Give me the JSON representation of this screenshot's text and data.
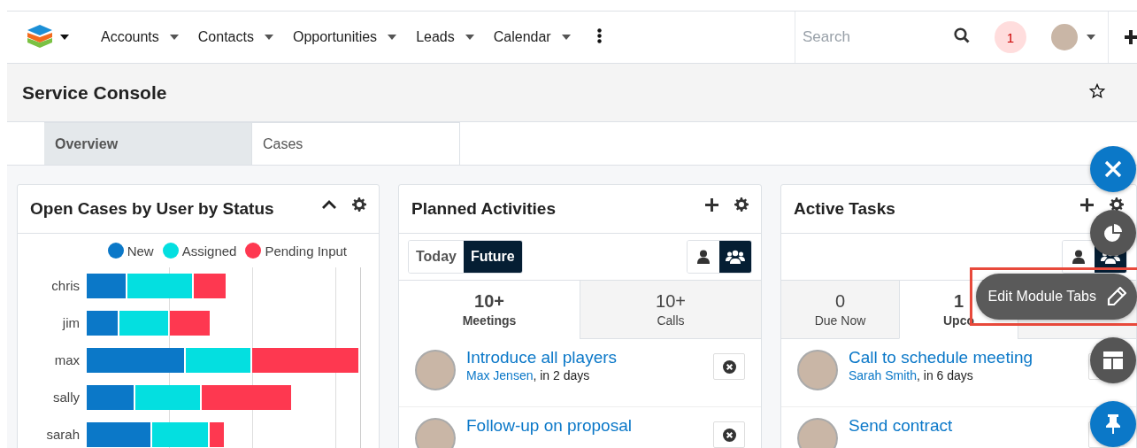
{
  "nav": {
    "menus": [
      {
        "label": "Accounts"
      },
      {
        "label": "Contacts"
      },
      {
        "label": "Opportunities"
      },
      {
        "label": "Leads"
      },
      {
        "label": "Calendar"
      }
    ],
    "search": {
      "placeholder": "Search"
    },
    "notification_count": "1"
  },
  "header": {
    "title": "Service Console",
    "favorite": false
  },
  "tabs": [
    {
      "label": "Overview",
      "selected": true
    },
    {
      "label": "Cases",
      "selected": false
    }
  ],
  "dashlets": [
    {
      "kind": "chart",
      "title": "Open Cases by User by Status",
      "collapsed": false,
      "legend": [
        {
          "label": "New",
          "color": "#0b78c8"
        },
        {
          "label": "Assigned",
          "color": "#04dfe0"
        },
        {
          "label": "Pending Input",
          "color": "#fe3850"
        }
      ],
      "users": [
        "chris",
        "jim",
        "max",
        "sally",
        "sarah"
      ]
    },
    {
      "kind": "list",
      "title": "Planned Activities",
      "filters": [
        {
          "label": "Today",
          "selected": false
        },
        {
          "label": "Future",
          "selected": true
        }
      ],
      "scope": [
        {
          "kind": "user",
          "selected": false
        },
        {
          "kind": "group",
          "selected": true
        }
      ],
      "tabs": [
        {
          "count": "10+",
          "label": "Meetings",
          "selected": true
        },
        {
          "count": "10+",
          "label": "Calls",
          "selected": false
        }
      ],
      "items": [
        {
          "title": "Introduce all players",
          "person": "Max Jensen",
          "when": ", in 2 days"
        },
        {
          "title": "Follow-up on proposal"
        }
      ]
    },
    {
      "kind": "list",
      "title": "Active Tasks",
      "scope": [
        {
          "kind": "user",
          "selected": false
        },
        {
          "kind": "group",
          "selected": true
        }
      ],
      "tabs": [
        {
          "count": "0",
          "label": "Due Now",
          "selected": false
        },
        {
          "count": "1",
          "label": "Upco",
          "selected": true
        },
        {
          "selected": false
        }
      ],
      "items": [
        {
          "title": "Call to schedule meeting",
          "person": "Sarah Smith",
          "when": ", in 6 days"
        },
        {
          "title": "Send contract"
        }
      ]
    }
  ],
  "fab": {
    "expanded": true,
    "actions": [
      {
        "kind": "pie"
      },
      {
        "kind": "edit",
        "label": "Edit Module Tabs",
        "highlighted": true
      },
      {
        "kind": "layout"
      },
      {
        "kind": "pin"
      }
    ]
  }
}
